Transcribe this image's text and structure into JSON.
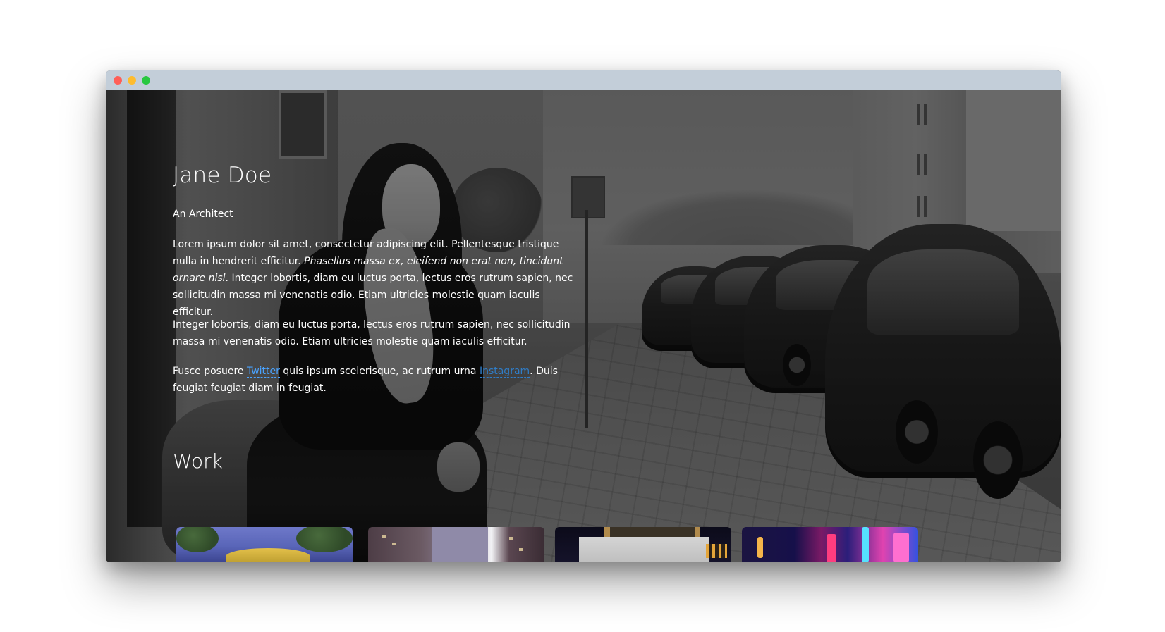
{
  "window": {
    "controls": {
      "close_color": "#ff5f57",
      "minimize_color": "#febc2e",
      "maximize_color": "#28c840"
    },
    "titlebar_color": "#c3ced9"
  },
  "profile": {
    "name": "Jane Doe",
    "role": "An Architect",
    "bio_1": {
      "text_a": "Lorem ipsum dolor sit amet, consectetur adipiscing elit. Pellentesque tristique nulla in hendrerit efficitur. ",
      "text_em": "Phasellus massa ex, eleifend non erat non, tincidunt ornare nisl",
      "text_b": ". Integer lobortis, diam eu luctus porta, lectus eros rutrum sapien, nec sollicitudin massa mi venenatis odio. Etiam ultricies molestie quam iaculis efficitur."
    },
    "bio_2": "Integer lobortis, diam eu luctus porta, lectus eros rutrum sapien, nec sollicitudin massa mi venenatis odio. Etiam ultricies molestie quam iaculis efficitur.",
    "bio_3": {
      "text_a": "Fusce posuere ",
      "link_1": "Twitter",
      "text_b": " quis ipsum scelerisque, ac rutrum urna ",
      "link_2": "Instagram",
      "text_c": ". Duis feugiat feugiat diam in feugiat."
    },
    "link_color": "#4aa3ff"
  },
  "work": {
    "heading": "Work",
    "items": [
      {
        "subject": "yellow-dome-building-with-trees"
      },
      {
        "subject": "city-high-rise-towers"
      },
      {
        "subject": "concrete-building-at-night"
      },
      {
        "subject": "neon-city-street"
      }
    ]
  },
  "background": {
    "subject": "grayscale-woman-sitting-on-city-sidewalk-with-parked-cars"
  }
}
